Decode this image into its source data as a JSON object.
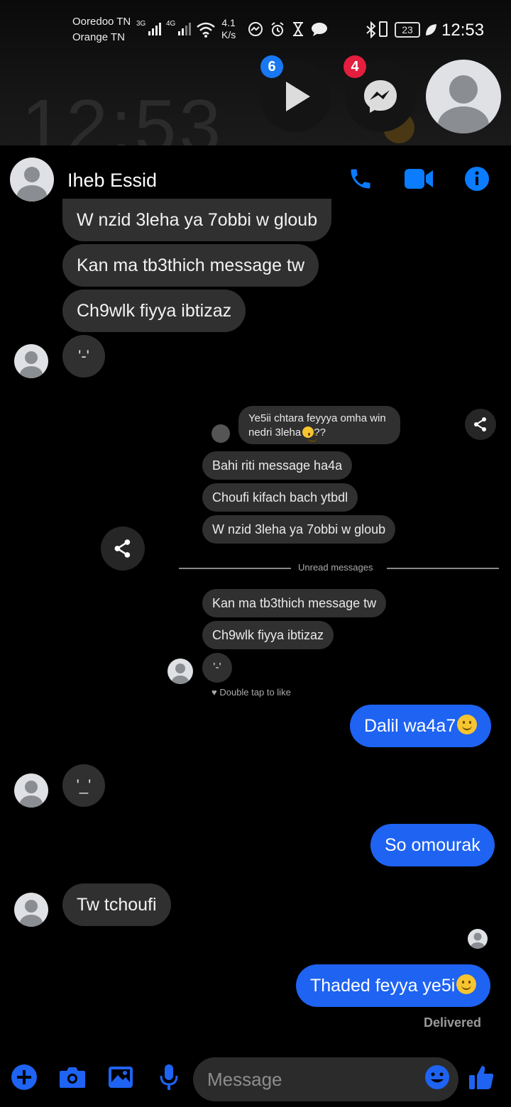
{
  "status_bar": {
    "carrier_1": "Ooredoo TN",
    "carrier_2": "Orange TN",
    "net_1": "3G",
    "net_2": "4G",
    "speed_value": "4.1",
    "speed_unit": "K/s",
    "battery": "23",
    "time": "12:53"
  },
  "lockscreen": {
    "clock": "12:53"
  },
  "chat_heads": [
    {
      "icon": "play-icon",
      "badge": "6",
      "badge_color": "#1877f2"
    },
    {
      "icon": "messenger-icon",
      "badge": "4",
      "badge_color": "#e41e3f"
    }
  ],
  "header": {
    "contact_name": "Iheb Essid"
  },
  "messages": {
    "m1": "W nzid 3leha ya 7obbi w gloub",
    "m2": "Kan ma tb3thich message tw",
    "m3": "Ch9wlk fiyya ibtizaz",
    "m4": "'-'",
    "m5": "Dalil wa4a7",
    "m6": "'_'",
    "m7": "So omourak",
    "m8": "Tw tchoufi",
    "m9": "Thaded feyya ye5i",
    "delivered": "Delivered"
  },
  "embedded_screenshot": {
    "reply_text": "Ye5ii chtara feyyya omha win nedri 3leha",
    "reply_suffix": "??",
    "s1": "Bahi riti message ha4a",
    "s2": "Choufi kifach bach ytbdl",
    "s3": "W nzid 3leha ya 7obbi w gloub",
    "unread": "Unread messages",
    "s4": "Kan ma tb3thich message tw",
    "s5": "Ch9wlk fiyya ibtizaz",
    "s6": "'-'",
    "double_tap": "Double tap to like"
  },
  "composer": {
    "placeholder": "Message"
  },
  "colors": {
    "accent": "#1e63f2",
    "icon_blue": "#0a7cff",
    "bubble_in": "#303030"
  }
}
